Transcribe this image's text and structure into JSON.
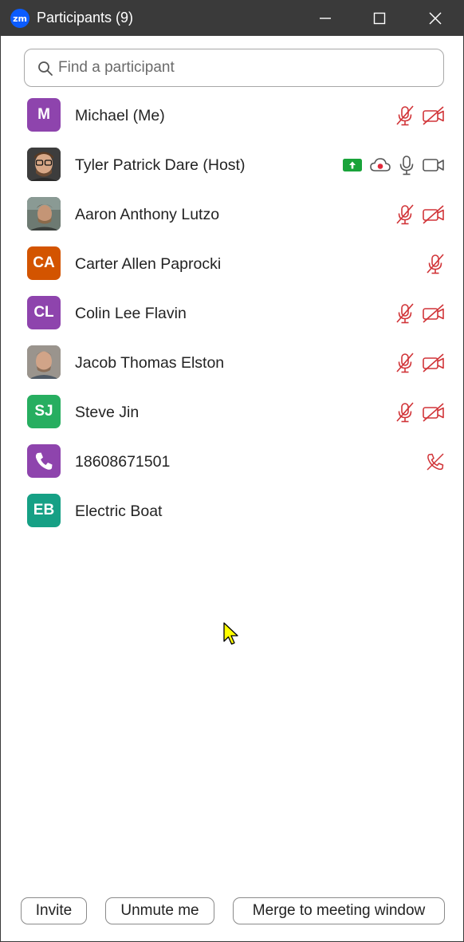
{
  "window": {
    "app_icon": "zm",
    "title": "Participants (9)"
  },
  "search": {
    "placeholder": "Find a participant",
    "value": ""
  },
  "participants": [
    {
      "name": "Michael (Me)",
      "initials": "M",
      "avatar_color": "#8e44ad",
      "avatar_type": "initials",
      "icons": [
        "mic-muted-icon",
        "video-off-icon"
      ]
    },
    {
      "name": "Tyler Patrick Dare (Host)",
      "initials": "",
      "avatar_color": "#4a4a4a",
      "avatar_type": "photo",
      "icons": [
        "share-screen-icon",
        "cloud-recording-icon",
        "mic-icon",
        "video-icon"
      ]
    },
    {
      "name": "Aaron Anthony Lutzo",
      "initials": "",
      "avatar_color": "#6d7a72",
      "avatar_type": "photo",
      "icons": [
        "mic-muted-icon",
        "video-off-icon"
      ]
    },
    {
      "name": "Carter Allen Paprocki",
      "initials": "CA",
      "avatar_color": "#d35400",
      "avatar_type": "initials",
      "icons": [
        "mic-muted-icon"
      ]
    },
    {
      "name": "Colin Lee Flavin",
      "initials": "CL",
      "avatar_color": "#8e44ad",
      "avatar_type": "initials",
      "icons": [
        "mic-muted-icon",
        "video-off-icon"
      ]
    },
    {
      "name": "Jacob Thomas Elston",
      "initials": "",
      "avatar_color": "#8a8580",
      "avatar_type": "photo",
      "icons": [
        "mic-muted-icon",
        "video-off-icon"
      ]
    },
    {
      "name": "Steve Jin",
      "initials": "SJ",
      "avatar_color": "#27ae60",
      "avatar_type": "initials",
      "icons": [
        "mic-muted-icon",
        "video-off-icon"
      ]
    },
    {
      "name": "18608671501",
      "initials": "",
      "avatar_color": "#8e44ad",
      "avatar_type": "phone",
      "icons": [
        "phone-muted-icon"
      ]
    },
    {
      "name": "Electric Boat",
      "initials": "EB",
      "avatar_color": "#16a085",
      "avatar_type": "initials",
      "icons": []
    }
  ],
  "footer": {
    "invite_label": "Invite",
    "unmute_label": "Unmute me",
    "merge_label": "Merge to meeting window"
  },
  "colors": {
    "muted_red": "#d13438",
    "share_green": "#19a33a",
    "titlebar": "#3a3a3a",
    "zoom_blue": "#0b5cff"
  }
}
